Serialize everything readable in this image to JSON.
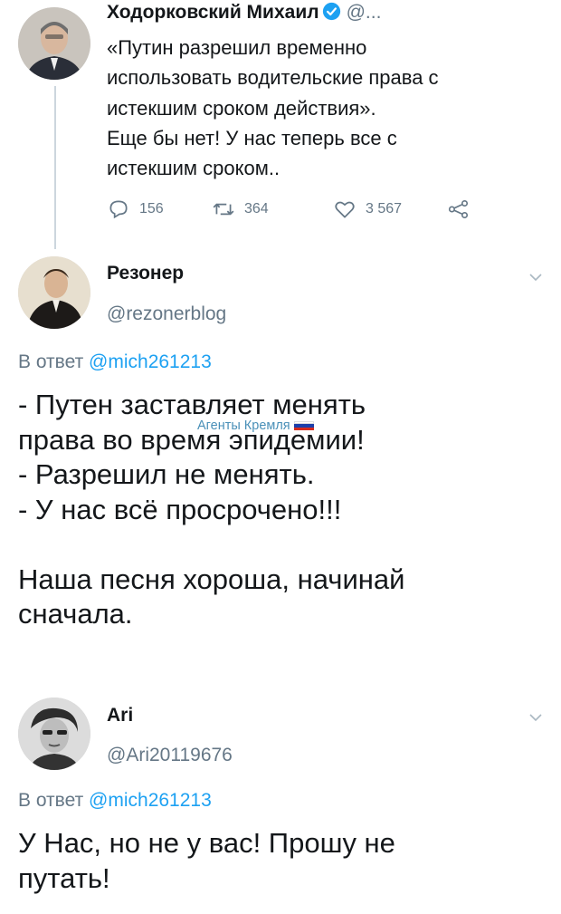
{
  "tweet": {
    "author_name": "Ходорковский Михаил",
    "author_handle": "@...",
    "text": "«Путин разрешил временно\nиспользовать водительские права с\nистекшим сроком действия».\nЕще бы нет! У нас теперь все с\nистекшим сроком..",
    "replies": "156",
    "retweets": "364",
    "likes": "3 567",
    "icons": [
      "verified-badge-icon",
      "reply-icon",
      "retweet-icon",
      "like-icon",
      "share-icon"
    ]
  },
  "reply1": {
    "author_name": "Резонер",
    "author_handle": "@rezonerblog",
    "reply_prefix": "В ответ",
    "reply_to": "@mich261213",
    "text": "- Путен заставляет менять\nправа во время эпидемии!\n- Разрешил не менять.\n- У нас всё просрочено!!!\n\nНаша песня хороша, начинай\nсначала."
  },
  "watermark": {
    "text": "Агенты Кремля",
    "flag_colors": [
      "#ffffff",
      "#1c3faa",
      "#d52b1e"
    ]
  },
  "reply2": {
    "author_name": "Ari",
    "author_handle": "@Ari20119676",
    "reply_prefix": "В ответ",
    "reply_to": "@mich261213",
    "text": "У Нас, но не у вас! Прошу не\nпутать!"
  },
  "colors": {
    "link": "#1da1f2",
    "secondary_text": "#657786",
    "verified": "#1da1f2"
  }
}
